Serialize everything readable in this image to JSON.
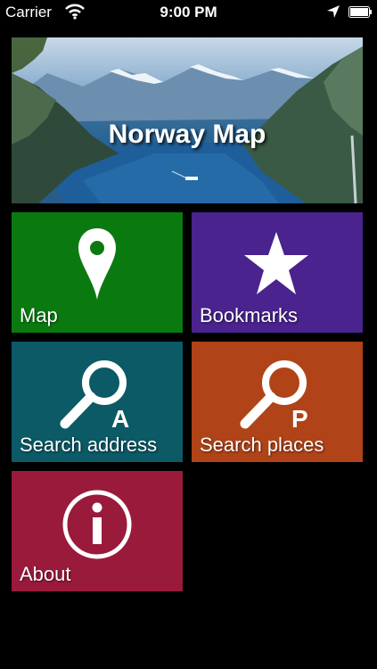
{
  "status_bar": {
    "carrier": "Carrier",
    "time": "9:00 PM"
  },
  "banner": {
    "title": "Norway Map"
  },
  "tiles": [
    {
      "label": "Map",
      "color": "#0a7a10",
      "icon": "map-pin-icon"
    },
    {
      "label": "Bookmarks",
      "color": "#4a238f",
      "icon": "star-icon"
    },
    {
      "label": "Search address",
      "color": "#0b5a66",
      "icon": "search-address-icon",
      "badge": "A"
    },
    {
      "label": "Search places",
      "color": "#b04418",
      "icon": "search-places-icon",
      "badge": "P"
    },
    {
      "label": "About",
      "color": "#9a1a3c",
      "icon": "info-icon"
    }
  ]
}
